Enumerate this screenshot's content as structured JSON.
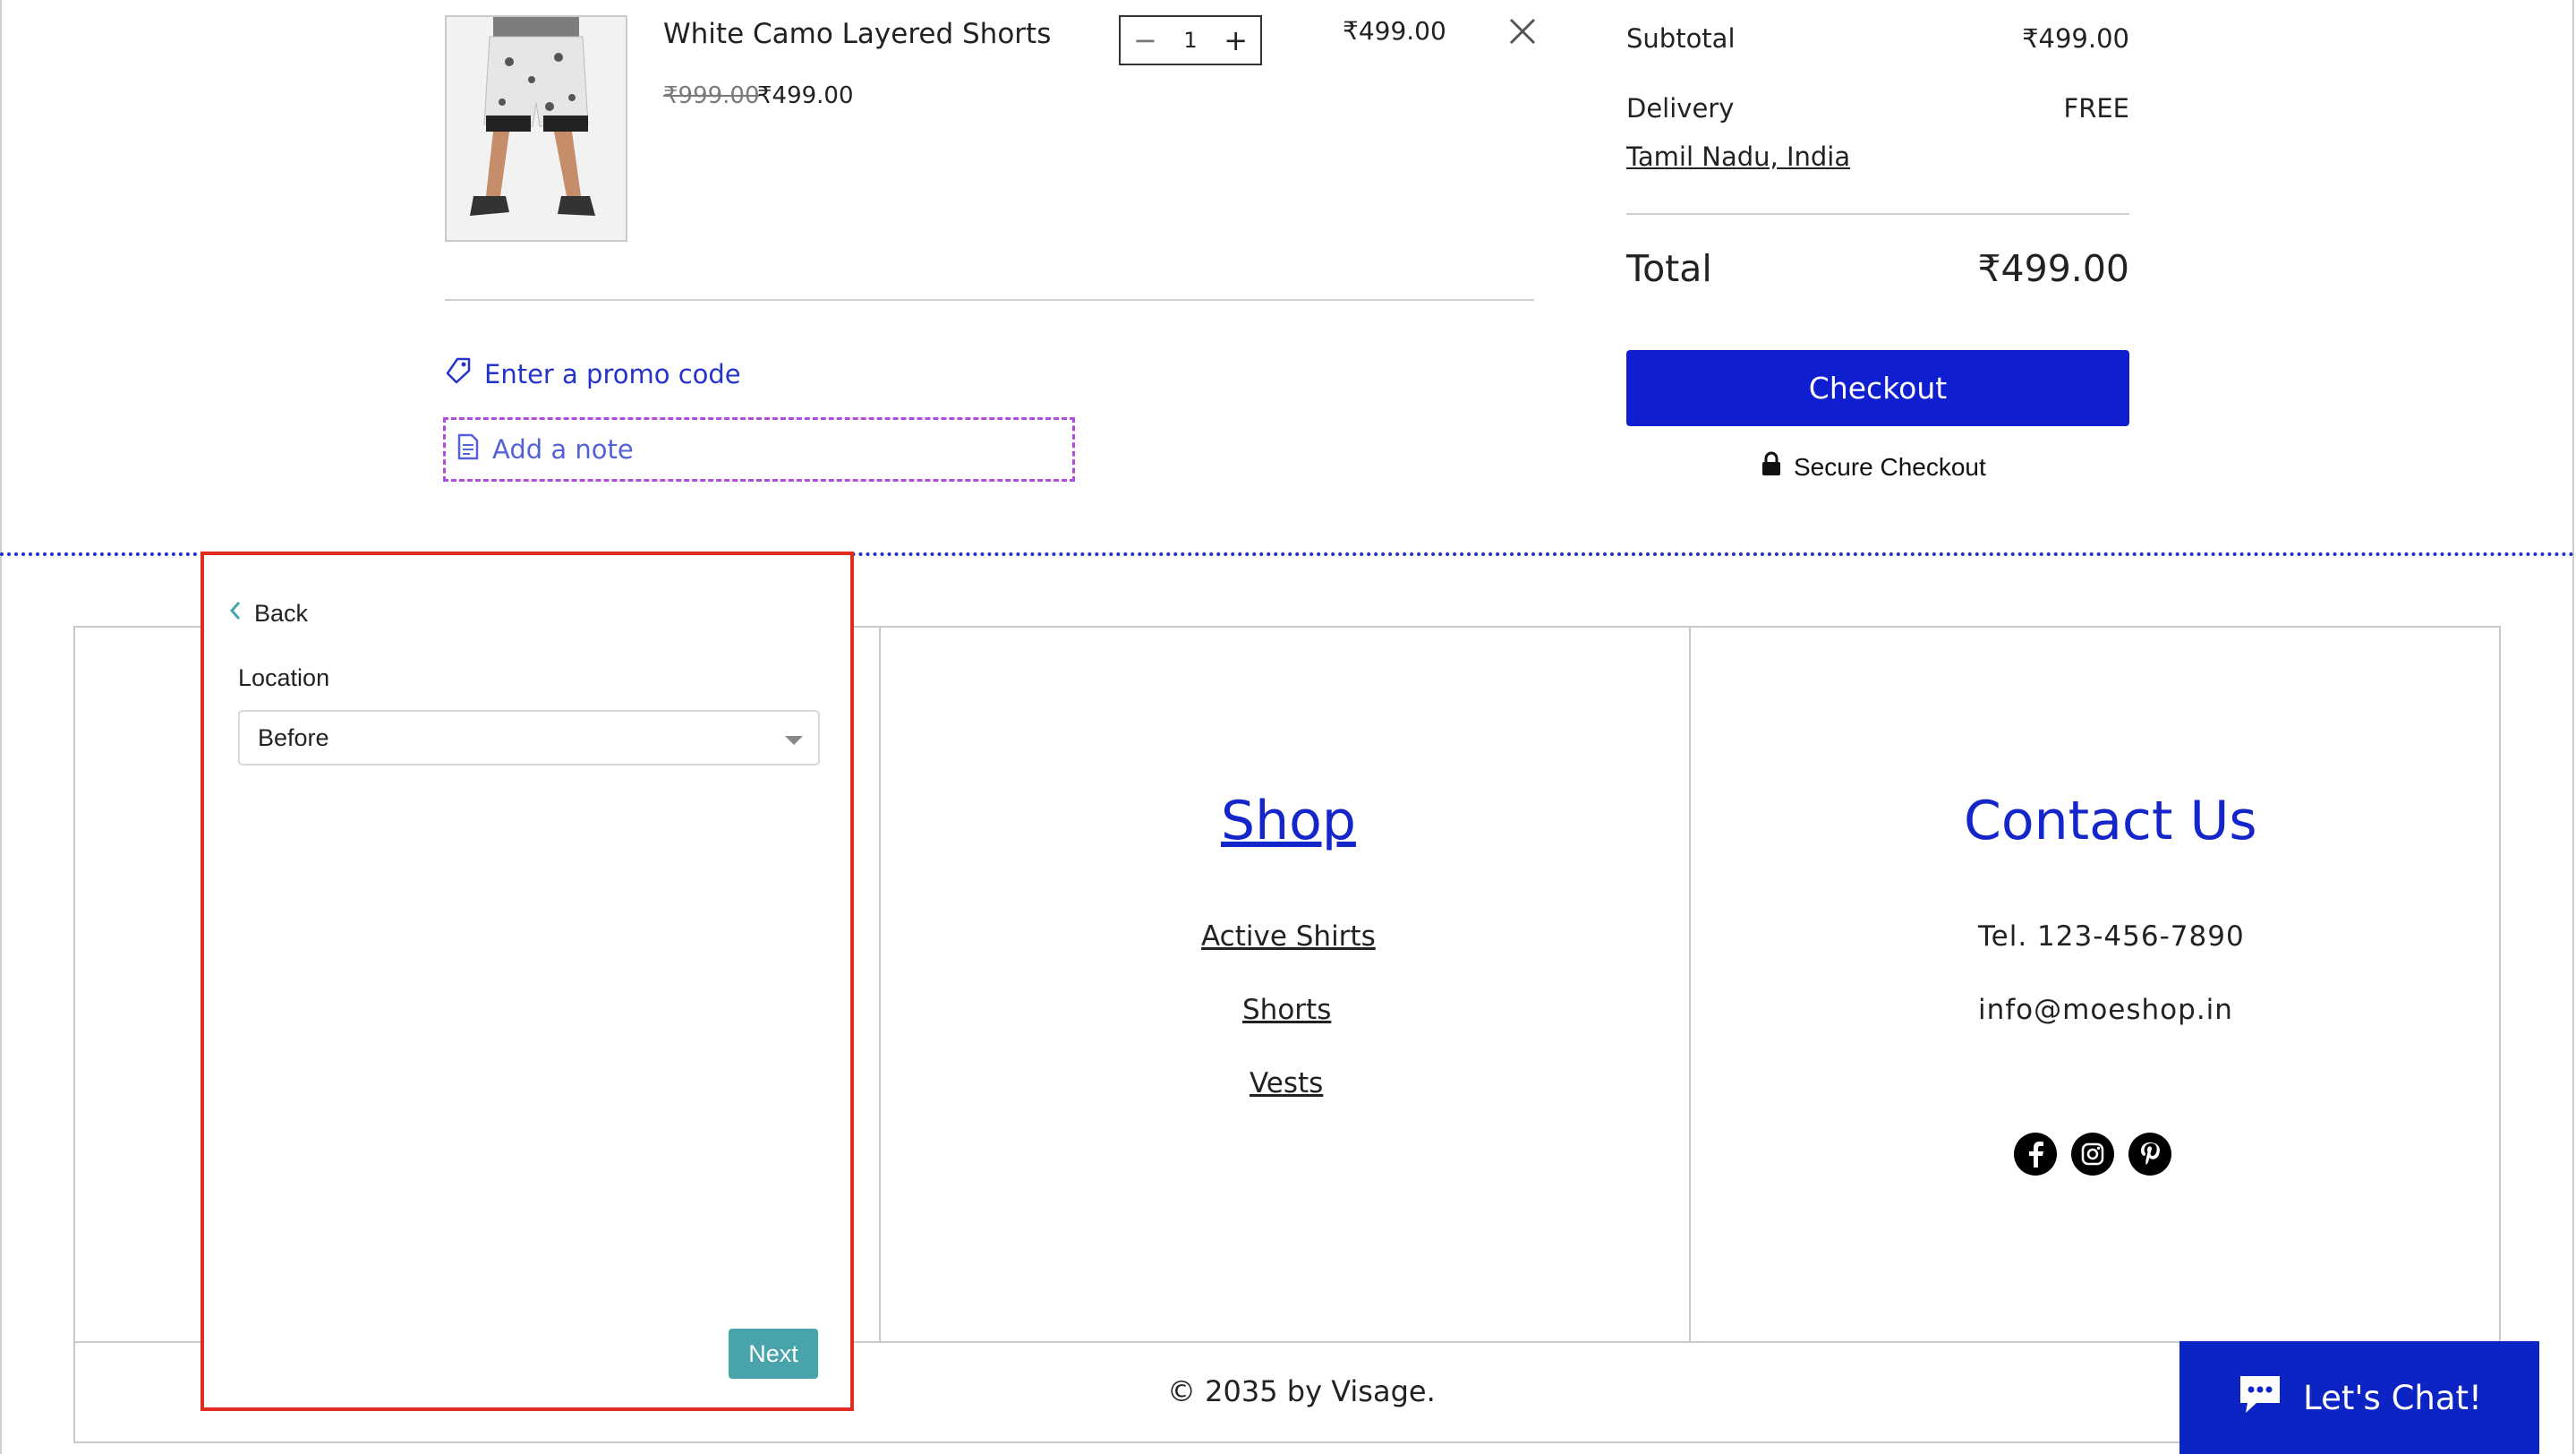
{
  "cart_item": {
    "name": "White Camo Layered Shorts",
    "old_price": "₹999.00",
    "price": "₹499.00",
    "quantity": "1",
    "line_total": "₹499.00"
  },
  "cart_actions": {
    "promo_label": "Enter a promo code",
    "note_label": "Add a note"
  },
  "summary": {
    "subtotal_label": "Subtotal",
    "subtotal_value": "₹499.00",
    "delivery_label": "Delivery",
    "delivery_value": "FREE",
    "region": "Tamil Nadu, India",
    "total_label": "Total",
    "total_value": "₹499.00",
    "checkout_label": "Checkout",
    "secure_label": "Secure Checkout"
  },
  "footer": {
    "shop_title": "Shop",
    "shop_links": [
      "Active Shirts",
      "Shorts",
      "Vests"
    ],
    "contact_title": "Contact Us",
    "phone": "Tel. 123-456-7890",
    "email": "info@moeshop.in",
    "social_icons": [
      "facebook-icon",
      "instagram-icon",
      "pinterest-icon"
    ],
    "copyright": "© 2035 by Visage."
  },
  "chat": {
    "label": "Let's Chat!"
  },
  "panel": {
    "back_label": "Back",
    "location_label": "Location",
    "location_value": "Before",
    "next_label": "Next"
  },
  "colors": {
    "brand_blue": "#0f1fd0",
    "link_blue": "#1426c9",
    "panel_border": "#e02b20",
    "next_button": "#48a4aa",
    "note_dash": "#b04de0"
  }
}
